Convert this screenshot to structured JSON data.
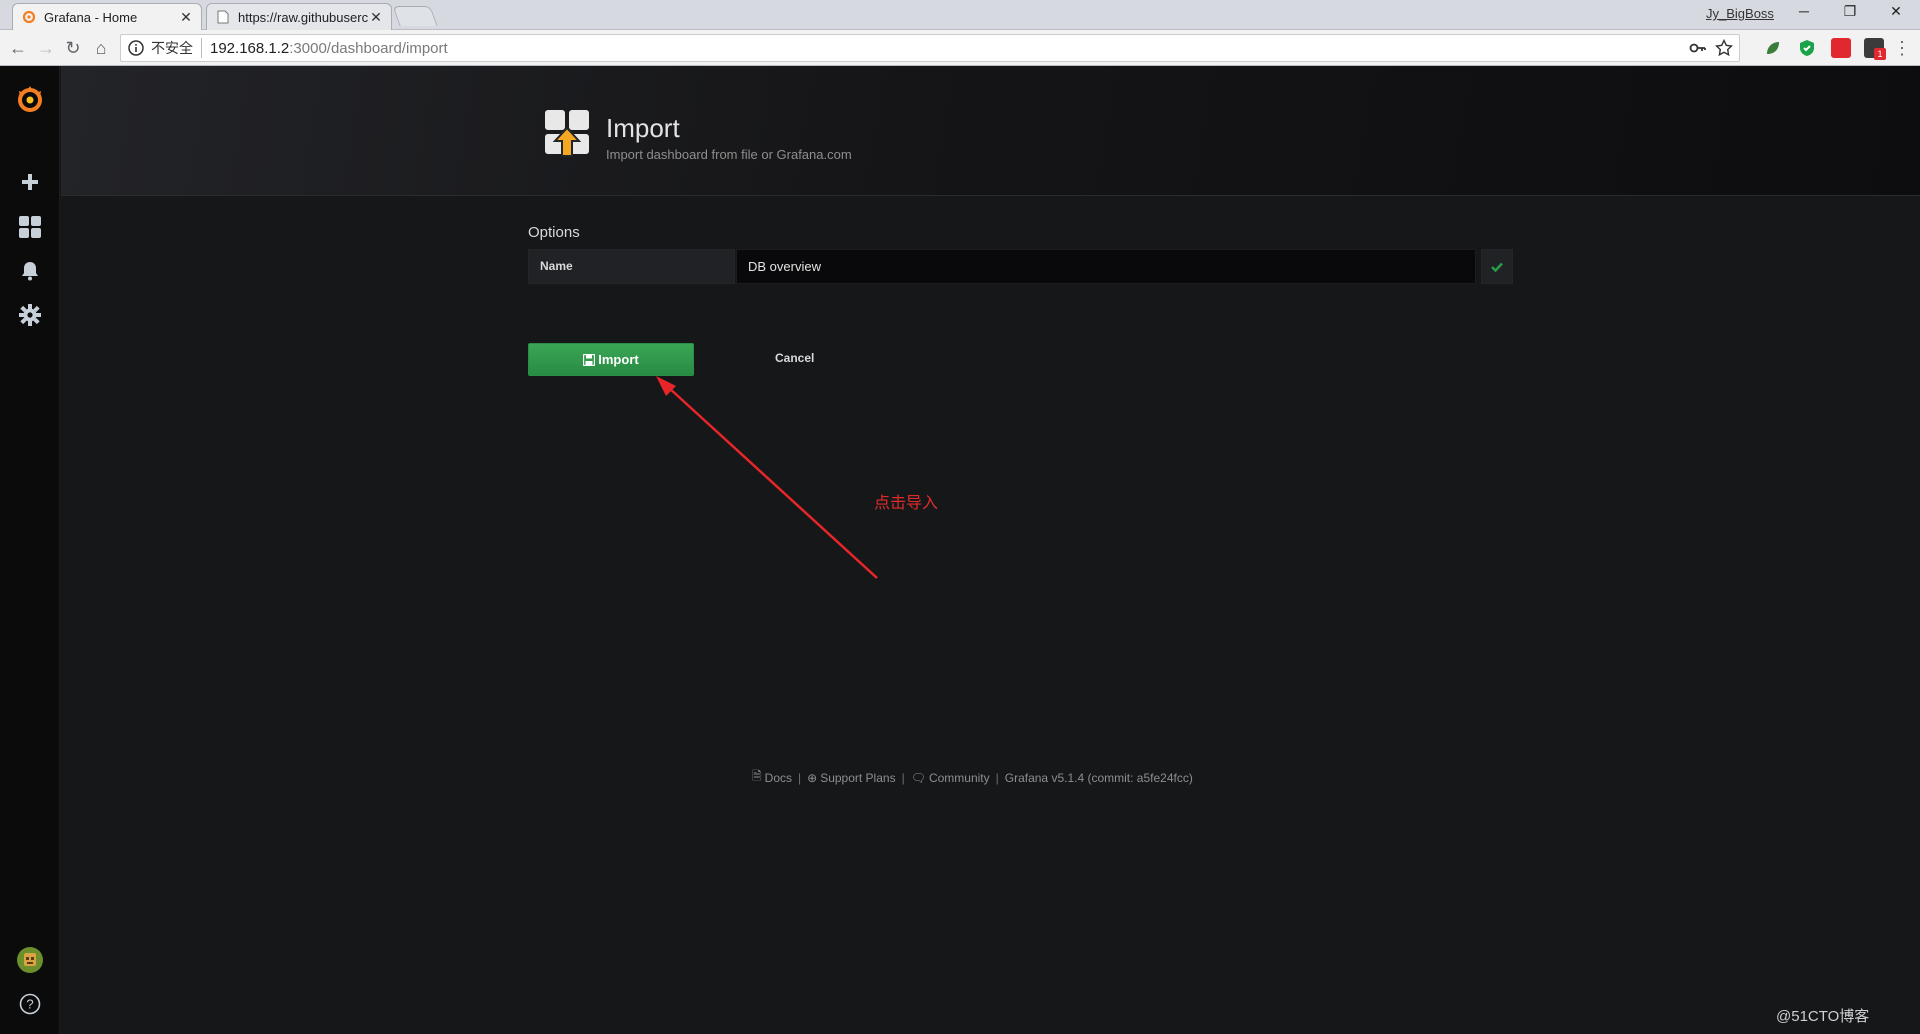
{
  "browser": {
    "tabs": [
      {
        "title": "Grafana - Home",
        "active": true
      },
      {
        "title": "https://raw.githubuserc",
        "active": false
      }
    ],
    "user": "Jy_BigBoss",
    "address": {
      "security_label": "不安全",
      "host": "192.168.1.2",
      "path": ":3000/dashboard/import"
    },
    "icons": {
      "back": "arrow-left-icon",
      "forward": "arrow-right-icon",
      "reload": "reload-icon",
      "home": "home-icon"
    }
  },
  "sidemenu": {
    "items": [
      "plus-icon",
      "dashboards-icon",
      "bell-icon",
      "gear-icon"
    ],
    "brand_color": "#f57f20"
  },
  "page": {
    "title": "Import",
    "subtitle": "Import dashboard from file or Grafana.com",
    "options_title": "Options",
    "name_label": "Name",
    "name_value": "DB overview",
    "import_button": "Import",
    "cancel_button": "Cancel",
    "accent_color": "#299c46"
  },
  "footer": {
    "docs": "Docs",
    "support": "Support Plans",
    "community": "Community",
    "version": "Grafana v5.1.4 (commit: a5fe24fcc)"
  },
  "annotation": {
    "text": "点击导入",
    "color": "#e02b2b"
  },
  "watermark": "@51CTO博客"
}
